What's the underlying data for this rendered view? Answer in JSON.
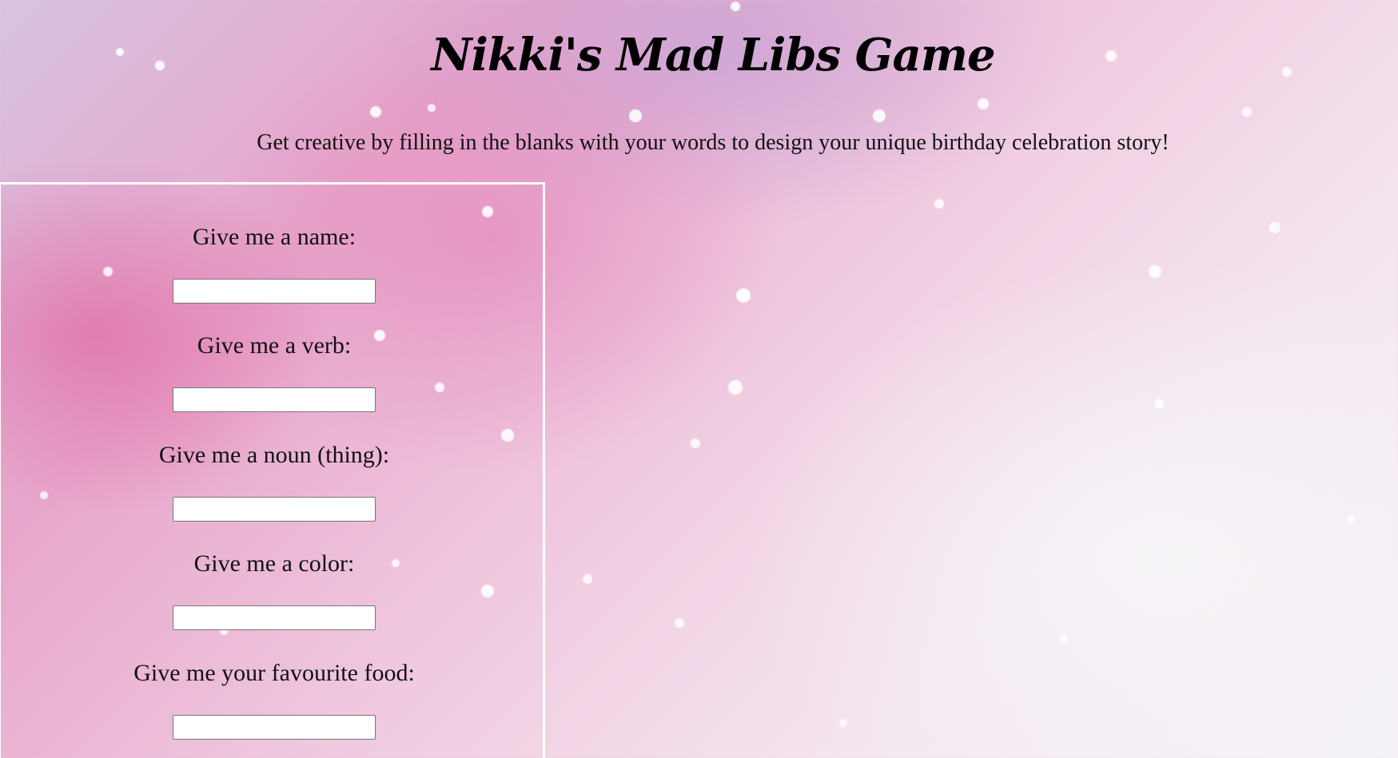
{
  "page": {
    "title": "Nikki's Mad Libs Game",
    "subtitle": "Get creative by filling in the blanks with your words to design your unique birthday celebration story!"
  },
  "form": {
    "fields": [
      {
        "label": "Give me a name:",
        "value": "",
        "placeholder": ""
      },
      {
        "label": "Give me a verb:",
        "value": "",
        "placeholder": ""
      },
      {
        "label": "Give me a noun (thing):",
        "value": "",
        "placeholder": ""
      },
      {
        "label": "Give me a color:",
        "value": "",
        "placeholder": ""
      },
      {
        "label": "Give me your favourite food:",
        "value": "",
        "placeholder": ""
      }
    ]
  },
  "colors": {
    "panel_border": "#ffffff",
    "text": "#111111",
    "background_pink": "#e7a6cb",
    "background_lavender": "#d8c3e2"
  }
}
